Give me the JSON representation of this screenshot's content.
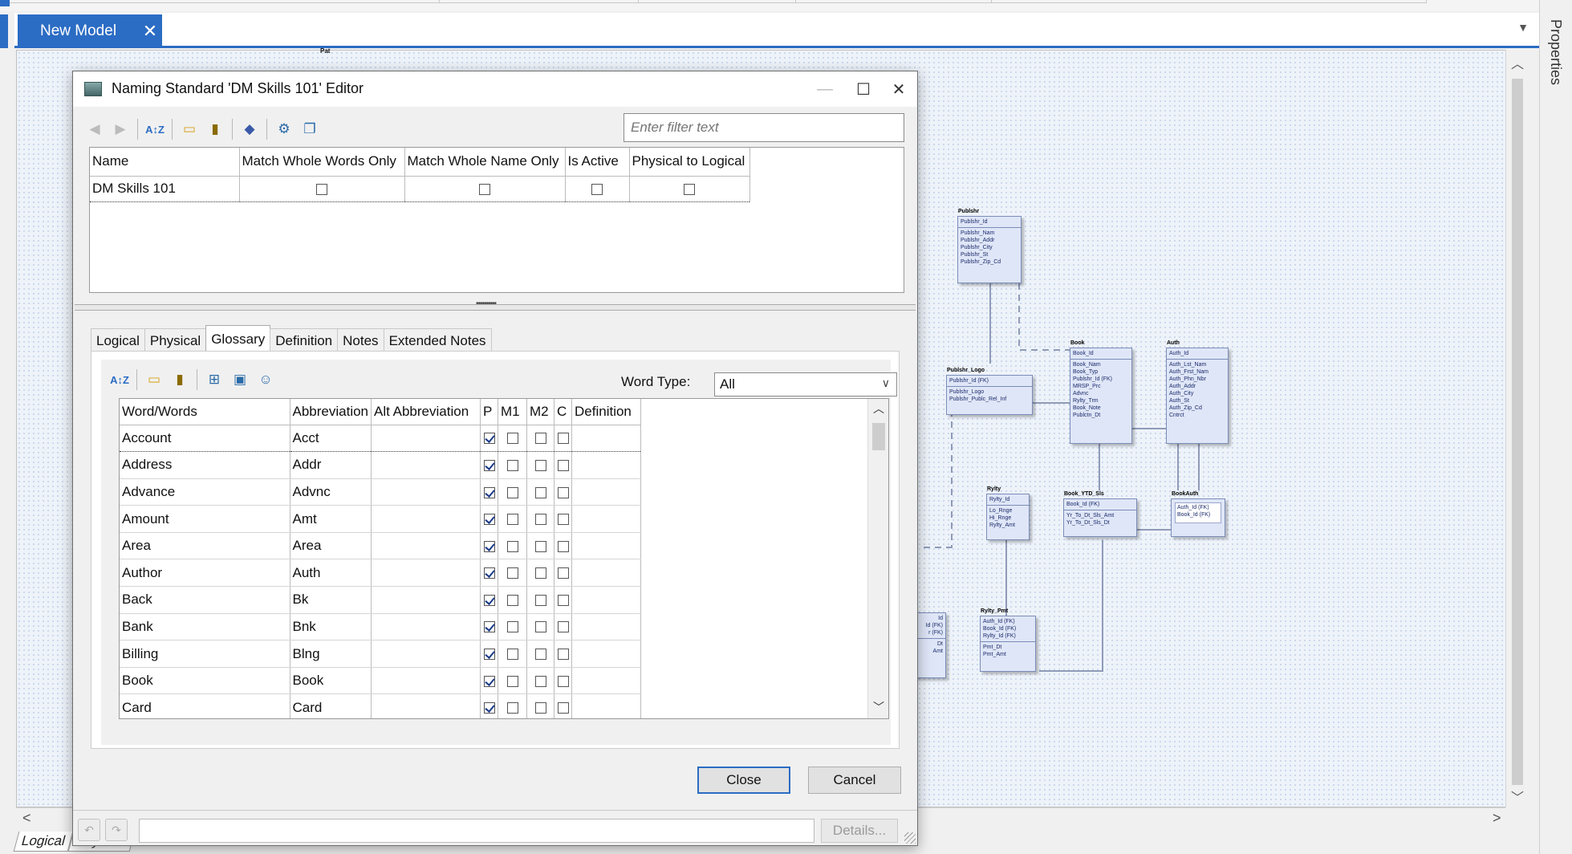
{
  "app": {
    "model_tab": "New Model",
    "model_tab_close": "✕",
    "properties_label": "Properties",
    "bottom_tabs": [
      "Logical",
      "Physical"
    ]
  },
  "diagram": {
    "top_label": "Pat",
    "entities": [
      {
        "name": "Publshr",
        "pk": [
          "Publshr_Id"
        ],
        "attrs": [
          "Publshr_Nam",
          "Publshr_Addr",
          "Publshr_City",
          "Publshr_St",
          "Publshr_Zip_Cd"
        ]
      },
      {
        "name": "Publshr_Logo",
        "pk": [
          "Publshr_Id (FK)"
        ],
        "attrs": [
          "Publshr_Logo",
          "Publshr_Publc_Rel_Inf"
        ]
      },
      {
        "name": "Book",
        "pk": [
          "Book_Id"
        ],
        "attrs": [
          "Book_Nam",
          "Book_Typ",
          "Publshr_Id (FK)",
          "MRSP_Prc",
          "Advnc",
          "Rylty_Trm",
          "Book_Note",
          "Publctn_Dt"
        ]
      },
      {
        "name": "Auth",
        "pk": [
          "Auth_Id"
        ],
        "attrs": [
          "Auth_Lst_Nam",
          "Auth_Frst_Nam",
          "Auth_Phn_Nbr",
          "Auth_Addr",
          "Auth_City",
          "Auth_St",
          "Auth_Zip_Cd",
          "Cntrct"
        ]
      },
      {
        "name": "Rylty",
        "pk": [
          "Rylty_Id"
        ],
        "attrs": [
          "Lo_Rnge",
          "Hi_Rnge",
          "Rylty_Amt"
        ]
      },
      {
        "name": "Book_YTD_Sls",
        "pk": [
          "Book_Id (FK)"
        ],
        "attrs": [
          "Yr_To_Dt_Sls_Amt",
          "Yr_To_Dt_Sls_Dt"
        ]
      },
      {
        "name": "BookAuth",
        "pk": [
          "Auth_Id (FK)",
          "Book_Id (FK)"
        ],
        "attrs": []
      },
      {
        "name": "Rylty_Pmt",
        "pk": [
          "Auth_Id (FK)",
          "Book_Id (FK)",
          "Rylty_Id (FK)"
        ],
        "attrs": [
          "Pmt_Dt",
          "Pmt_Amt"
        ]
      },
      {
        "name": "",
        "pk": [
          "Id",
          "Id (FK)",
          "r (FK)"
        ],
        "attrs": [
          "Dt",
          "Amt"
        ]
      }
    ]
  },
  "dialog": {
    "title": "Naming Standard 'DM Skills 101' Editor",
    "window_controls": {
      "minimize": "—",
      "maximize": "☐",
      "close": "✕"
    },
    "filter_placeholder": "Enter filter text",
    "toolbar_icons": [
      "back-arrow-icon",
      "forward-arrow-icon",
      "sort-az-icon",
      "new-folder-icon",
      "delete-icon",
      "tag-icon",
      "gear-puzzle-icon",
      "copy-icon"
    ],
    "standards_table": {
      "columns": [
        "Name",
        "Match Whole Words Only",
        "Match Whole Name Only",
        "Is Active",
        "Physical to Logical"
      ],
      "rows": [
        {
          "name": "DM Skills 101",
          "match_whole_words": false,
          "match_whole_name": false,
          "is_active": false,
          "physical_to_logical": false
        }
      ]
    },
    "tabs": [
      "Logical",
      "Physical",
      "Glossary",
      "Definition",
      "Notes",
      "Extended Notes"
    ],
    "active_tab": "Glossary",
    "glossary": {
      "word_type_label": "Word Type:",
      "word_type_value": "All",
      "toolbar_icons": [
        "sort-az-icon",
        "new-folder-icon",
        "delete-icon",
        "import-icon",
        "save-icon",
        "users-icon"
      ],
      "columns": [
        "Word/Words",
        "Abbreviation",
        "Alt Abbreviation",
        "P",
        "M1",
        "M2",
        "C",
        "Definition"
      ],
      "rows": [
        {
          "word": "Account",
          "abbr": "Acct",
          "alt": "",
          "p": true,
          "m1": false,
          "m2": false,
          "c": false,
          "definition": ""
        },
        {
          "word": "Address",
          "abbr": "Addr",
          "alt": "",
          "p": true,
          "m1": false,
          "m2": false,
          "c": false,
          "definition": ""
        },
        {
          "word": "Advance",
          "abbr": "Advnc",
          "alt": "",
          "p": true,
          "m1": false,
          "m2": false,
          "c": false,
          "definition": ""
        },
        {
          "word": "Amount",
          "abbr": "Amt",
          "alt": "",
          "p": true,
          "m1": false,
          "m2": false,
          "c": false,
          "definition": ""
        },
        {
          "word": "Area",
          "abbr": "Area",
          "alt": "",
          "p": true,
          "m1": false,
          "m2": false,
          "c": false,
          "definition": ""
        },
        {
          "word": "Author",
          "abbr": "Auth",
          "alt": "",
          "p": true,
          "m1": false,
          "m2": false,
          "c": false,
          "definition": ""
        },
        {
          "word": "Back",
          "abbr": "Bk",
          "alt": "",
          "p": true,
          "m1": false,
          "m2": false,
          "c": false,
          "definition": ""
        },
        {
          "word": "Bank",
          "abbr": "Bnk",
          "alt": "",
          "p": true,
          "m1": false,
          "m2": false,
          "c": false,
          "definition": ""
        },
        {
          "word": "Billing",
          "abbr": "Blng",
          "alt": "",
          "p": true,
          "m1": false,
          "m2": false,
          "c": false,
          "definition": ""
        },
        {
          "word": "Book",
          "abbr": "Book",
          "alt": "",
          "p": true,
          "m1": false,
          "m2": false,
          "c": false,
          "definition": ""
        },
        {
          "word": "Card",
          "abbr": "Card",
          "alt": "",
          "p": true,
          "m1": false,
          "m2": false,
          "c": false,
          "definition": ""
        }
      ]
    },
    "buttons": {
      "close": "Close",
      "cancel": "Cancel",
      "details": "Details..."
    },
    "status_icons": [
      "undo-icon",
      "redo-icon"
    ]
  },
  "colors": {
    "accent": "#2b6cc4",
    "canvas": "#eef3fa",
    "entity_fill": "#dfe6f7",
    "entity_border": "#7a8cb8",
    "checkmark": "#1a3a8a"
  }
}
